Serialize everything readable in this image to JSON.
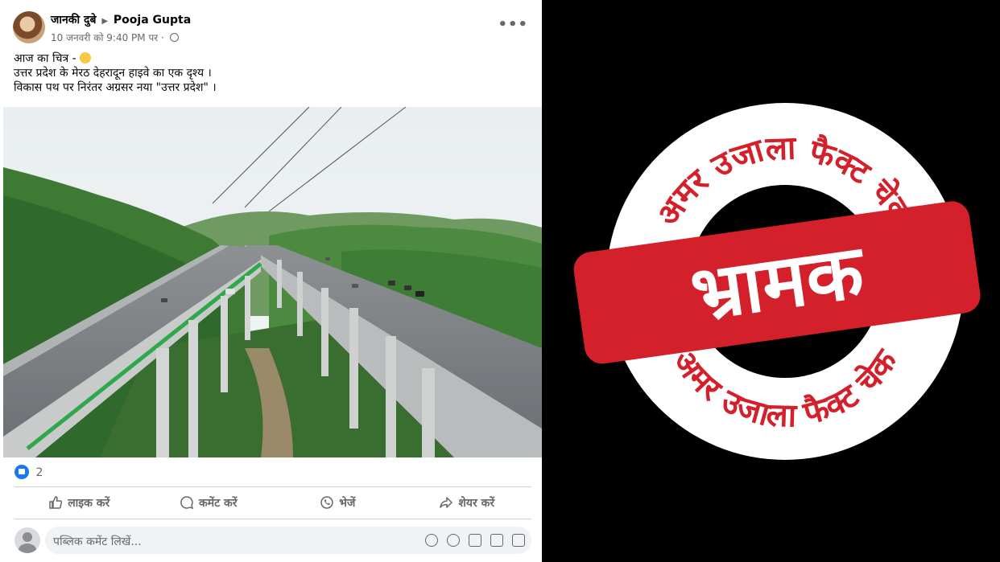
{
  "post": {
    "author": "जानकी दुबे",
    "shared_to": "Pooja Gupta",
    "timestamp": "10 जनवरी को 9:40 PM पर ·",
    "more_label": "•••",
    "text_lines": [
      "आज का चित्र - ",
      "उत्तर प्रदेश के मेरठ देहरादून हाइवे का एक दृश्य ।",
      "विकास पथ पर निरंतर अग्रसर नया \"उत्तर प्रदेश\" ।"
    ],
    "reaction_count": "2"
  },
  "actions": {
    "like": "लाइक करें",
    "comment": "कमेंट करें",
    "send": "भेजें",
    "share": "शेयर करें"
  },
  "comment": {
    "placeholder": "पब्लिक कमेंट लिखें..."
  },
  "stamp": {
    "ring_text_top": "अमर उजाला फैक्ट चेक",
    "ring_text_bottom": "अमर उजाला फैक्ट चेक",
    "verdict": "भ्रामक"
  },
  "colors": {
    "stamp_red": "#d3202a",
    "facebook_blue": "#1877f2"
  }
}
